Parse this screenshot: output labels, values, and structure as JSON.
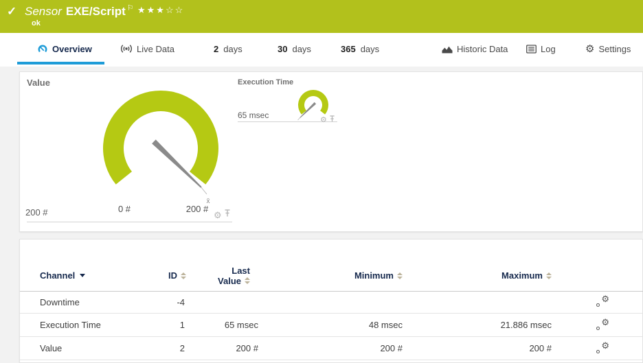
{
  "header": {
    "status_icon": "✓",
    "kind": "Sensor",
    "name": "EXE/Script",
    "flag": "⚐",
    "stars": "★★★☆☆",
    "status": "ok",
    "bg_color": "#b2c11c"
  },
  "tabs": [
    {
      "label": "Overview",
      "icon": "gauge-icon",
      "active": true
    },
    {
      "label": "Live Data",
      "icon": "broadcast-icon"
    },
    {
      "number": "2",
      "unit": "days"
    },
    {
      "number": "30",
      "unit": "days"
    },
    {
      "number": "365",
      "unit": "days"
    },
    {
      "label": "Historic Data",
      "icon": "area-chart-icon"
    },
    {
      "label": "Log",
      "icon": "log-icon"
    },
    {
      "label": "Settings",
      "icon": "gear-icon"
    }
  ],
  "gauges": {
    "value": {
      "title": "Value",
      "unit": "#",
      "min": 0,
      "max": 200,
      "current": 200,
      "min_label": "0 #",
      "max_label": "200 #",
      "current_label": "200 #",
      "avg_marker": "x̄",
      "arc_color": "#b5c913",
      "needle_color": "#8a8a8a"
    },
    "execution": {
      "title": "Execution Time",
      "current": 65,
      "current_label": "65 msec",
      "arc_color": "#b5c913",
      "needle_color": "#8a8a8a"
    }
  },
  "table": {
    "headers": {
      "channel": "Channel",
      "id": "ID",
      "last_line1": "Last",
      "last_line2": "Value",
      "minimum": "Minimum",
      "maximum": "Maximum"
    },
    "rows": [
      {
        "channel": "Downtime",
        "id": "-4",
        "last": "",
        "min": "",
        "max": ""
      },
      {
        "channel": "Execution Time",
        "id": "1",
        "last": "65 msec",
        "min": "48 msec",
        "max": "21.886 msec"
      },
      {
        "channel": "Value",
        "id": "2",
        "last": "200 #",
        "min": "200 #",
        "max": "200 #"
      }
    ]
  },
  "colors": {
    "accent_blue": "#1e9cd8",
    "status_green": "#b2c11c",
    "gauge_green": "#b5c913"
  }
}
